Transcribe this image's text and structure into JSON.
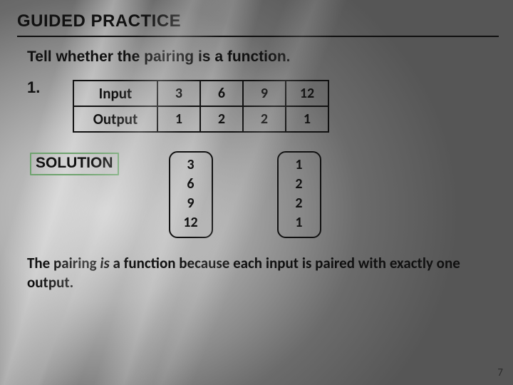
{
  "title": "GUIDED PRACTICE",
  "prompt": "Tell whether the pairing is a function.",
  "question_number": "1.",
  "table": {
    "row_labels": [
      "Input",
      "Output"
    ],
    "inputs": [
      "3",
      "6",
      "9",
      "12"
    ],
    "outputs": [
      "1",
      "2",
      "2",
      "1"
    ]
  },
  "solution_label": "SOLUTION",
  "mapping": {
    "left": [
      "3",
      "6",
      "9",
      "12"
    ],
    "right": [
      "1",
      "2",
      "2",
      "1"
    ]
  },
  "explain_pre": "The pairing ",
  "explain_is": "is",
  "explain_post": " a function because each input is paired with exactly one output.",
  "page_number": "7",
  "chart_data": {
    "type": "table",
    "title": "Input/Output pairing",
    "categories": [
      "Input",
      "Output"
    ],
    "series": [
      {
        "name": "Input",
        "values": [
          3,
          6,
          9,
          12
        ]
      },
      {
        "name": "Output",
        "values": [
          1,
          2,
          2,
          1
        ]
      }
    ]
  }
}
